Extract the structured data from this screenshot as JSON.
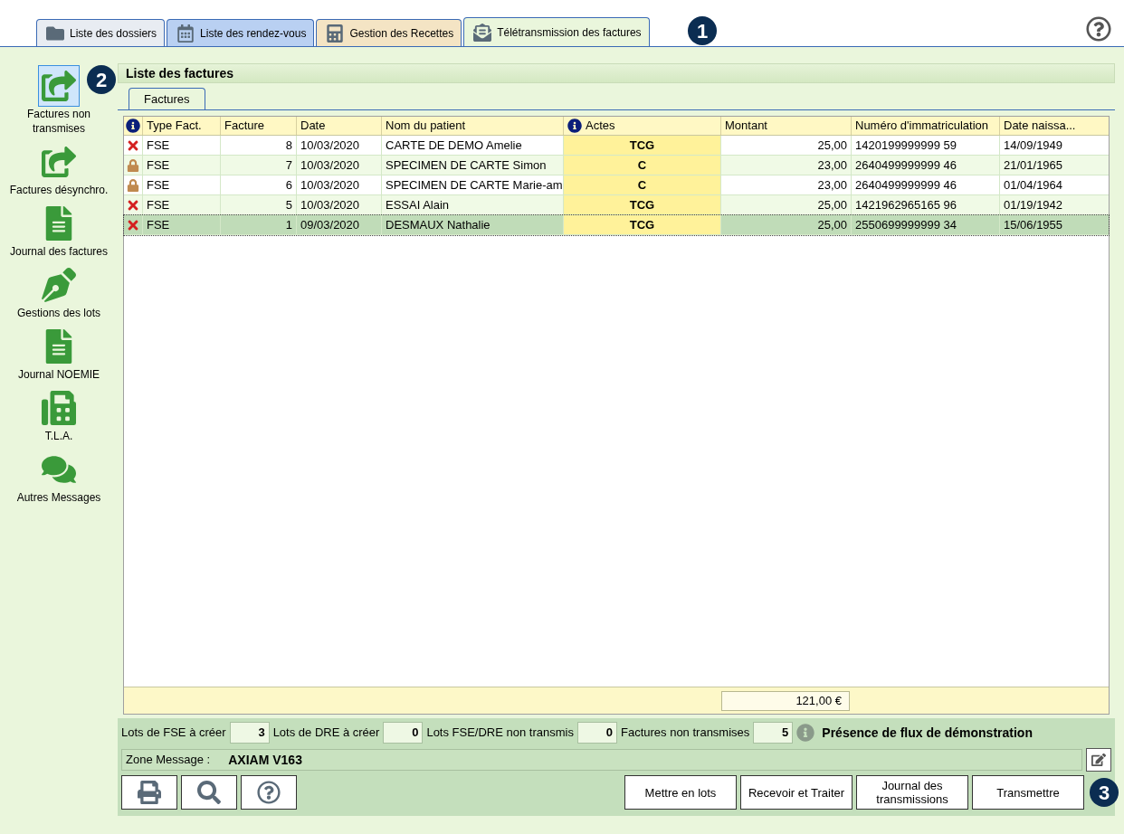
{
  "tabs": [
    {
      "label": "Liste des dossiers",
      "selected": false
    },
    {
      "label": "Liste des rendez-vous",
      "selected": false
    },
    {
      "label": "Gestion des Recettes",
      "selected": false
    },
    {
      "label": "Télétransmission des factures",
      "selected": true
    }
  ],
  "callouts": [
    "1",
    "2",
    "3"
  ],
  "sidebar": {
    "items": [
      {
        "label": "Factures non transmises",
        "selected": true
      },
      {
        "label": "Factures désynchro.",
        "selected": false
      },
      {
        "label": "Journal des factures",
        "selected": false
      },
      {
        "label": "Gestions des lots",
        "selected": false
      },
      {
        "label": "Journal NOEMIE",
        "selected": false
      },
      {
        "label": "T.L.A.",
        "selected": false
      },
      {
        "label": "Autres Messages",
        "selected": false
      }
    ]
  },
  "panel": {
    "title": "Liste des factures",
    "subtabs": [
      {
        "label": "Factures",
        "selected": true
      }
    ]
  },
  "table": {
    "columns": [
      "Type Fact.",
      "Facture",
      "Date",
      "Nom du patient",
      "Actes",
      "Montant",
      "Numéro d'immatriculation",
      "Date naissa..."
    ],
    "rows": [
      {
        "kind": "rejected",
        "cells": [
          "FSE",
          "8",
          "10/03/2020",
          "CARTE DE DEMO Amelie",
          "TCG",
          "25,00",
          "1420199999999 59",
          "14/09/1949"
        ],
        "selected": false
      },
      {
        "kind": "locked",
        "cells": [
          "FSE",
          "7",
          "10/03/2020",
          "SPECIMEN DE CARTE Simon",
          "C",
          "23,00",
          "2640499999999 46",
          "21/01/1965"
        ],
        "selected": false
      },
      {
        "kind": "locked",
        "cells": [
          "FSE",
          "6",
          "10/03/2020",
          "SPECIMEN DE CARTE Marie-am",
          "C",
          "23,00",
          "2640499999999 46",
          "01/04/1964"
        ],
        "selected": false
      },
      {
        "kind": "rejected",
        "cells": [
          "FSE",
          "5",
          "10/03/2020",
          "ESSAI Alain",
          "TCG",
          "25,00",
          "1421962965165 96",
          "01/19/1942"
        ],
        "selected": false
      },
      {
        "kind": "rejected",
        "cells": [
          "FSE",
          "1",
          "09/03/2020",
          "DESMAUX Nathalie",
          "TCG",
          "25,00",
          "2550699999999 34",
          "15/06/1955"
        ],
        "selected": true
      }
    ],
    "total": "121,00 €"
  },
  "counters": [
    {
      "label": "Lots de FSE à créer",
      "value": "3"
    },
    {
      "label": "Lots de DRE à créer",
      "value": "0"
    },
    {
      "label": "Lots FSE/DRE non transmis",
      "value": "0"
    },
    {
      "label": "Factures non transmises",
      "value": "5"
    }
  ],
  "demo_notice": "Présence de flux de démonstration",
  "message": {
    "label": "Zone Message :",
    "value": "AXIAM V163"
  },
  "buttons": [
    "Mettre en lots",
    "Recevoir et Traiter",
    "Journal des transmissions",
    "Transmettre"
  ]
}
